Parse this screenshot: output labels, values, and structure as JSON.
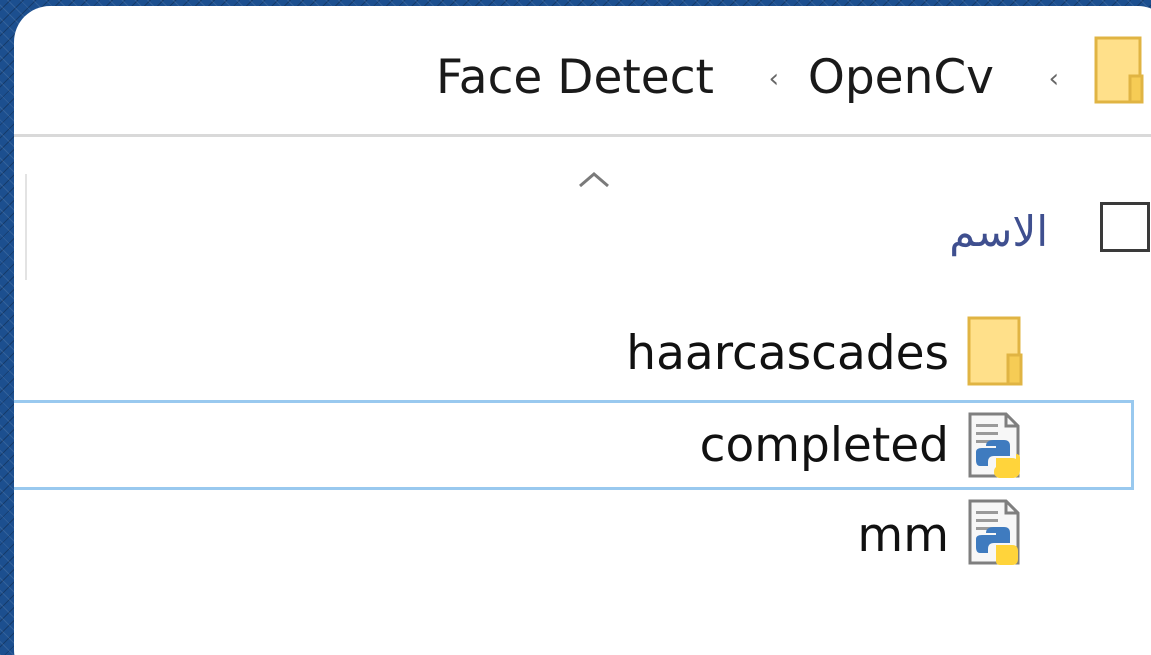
{
  "breadcrumb": {
    "items": [
      "Face Detect",
      "OpenCv"
    ],
    "separator": "‹"
  },
  "column_header": {
    "name_label": "الاسم"
  },
  "files": [
    {
      "name": "haarcascades",
      "icon": "folder-icon"
    },
    {
      "name": "completed",
      "icon": "python-file-icon",
      "selected": true
    },
    {
      "name": "mm",
      "icon": "python-file-icon"
    }
  ],
  "colors": {
    "folder": "#ffd966",
    "selection_border": "#99c9ef",
    "header_text": "#3f4f8f",
    "python_blue": "#3f7bbf",
    "python_yellow": "#ffd43b"
  }
}
